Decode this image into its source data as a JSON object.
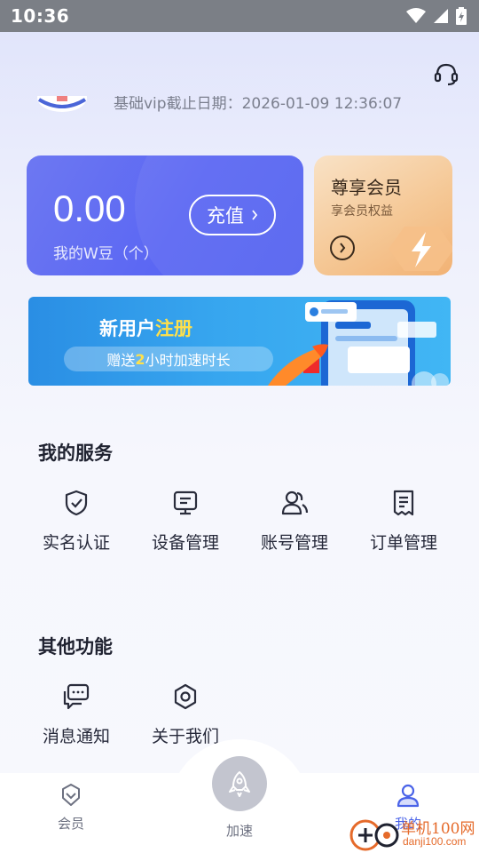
{
  "status_bar": {
    "time": "10:36"
  },
  "profile": {
    "vip_expiry_text": "基础vip截止日期：2026-01-09 12:36:07"
  },
  "wallet": {
    "balance": "0.00",
    "unit_label": "我的W豆（个）",
    "recharge_label": "充值"
  },
  "member_card": {
    "title": "尊享会员",
    "subtitle": "享会员权益"
  },
  "banner": {
    "headline_part1": "新用户",
    "headline_part2": "注册",
    "pill_part1": "赠送",
    "pill_part2": "2",
    "pill_part3": "小时加速时长"
  },
  "services": {
    "title": "我的服务",
    "items": [
      {
        "label": "实名认证",
        "icon": "shield-check-icon"
      },
      {
        "label": "设备管理",
        "icon": "monitor-icon"
      },
      {
        "label": "账号管理",
        "icon": "users-icon"
      },
      {
        "label": "订单管理",
        "icon": "receipt-icon"
      }
    ]
  },
  "other": {
    "title": "其他功能",
    "items": [
      {
        "label": "消息通知",
        "icon": "message-icon"
      },
      {
        "label": "关于我们",
        "icon": "hexagon-icon"
      }
    ]
  },
  "tab_bar": {
    "tabs": [
      {
        "label": "会员",
        "icon": "diamond-icon",
        "active": false
      },
      {
        "label": "加速",
        "icon": "rocket-icon",
        "active": false
      },
      {
        "label": "我的",
        "icon": "person-icon",
        "active": true
      }
    ]
  },
  "watermark": {
    "line1": "单机100网",
    "line2": "danji100.com"
  },
  "colors": {
    "accent": "#5b67f3",
    "member_gold": "#f5c896",
    "banner_blue": "#37a6ef",
    "highlight_yellow": "#ffe04a",
    "active_tab": "#4a63e8"
  }
}
